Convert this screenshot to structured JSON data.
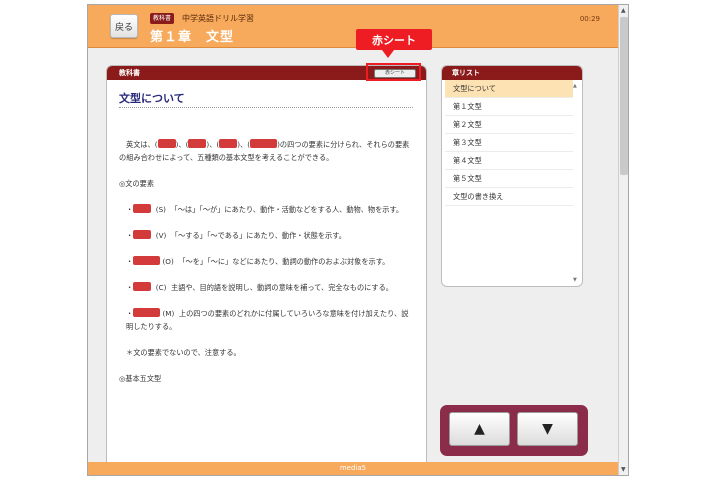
{
  "header": {
    "back_label": "戻る",
    "badge": "教科書",
    "app_title": "中学英語ドリル学習",
    "chapter_title": "第１章　文型",
    "timer": "00:29"
  },
  "content": {
    "panel_label": "教科書",
    "red_sheet_button": "赤シート",
    "doc_title": "文型について",
    "intro_a": "英文は、",
    "intro_sep": "、",
    "intro_b": "の四つの要素に分けられ、それらの要素の組み合わせによって、五種類の基本文型を考えることができる。",
    "section1": "◎文の要素",
    "items": [
      {
        "bullet": "・",
        "code": "(S)",
        "text": "「〜は」「〜が」にあたり、動作・活動などをする人、動物、物を示す。"
      },
      {
        "bullet": "・",
        "code": "(V)",
        "text": "「〜する」「〜である」にあたり、動作・状態を示す。"
      },
      {
        "bullet": "・",
        "code": "(O)",
        "text": "「〜を」「〜に」などにあたり、動詞の動作のおよぶ対象を示す。"
      },
      {
        "bullet": "・",
        "code": "(C)",
        "text": "主語や、目的語を説明し、動詞の意味を補って、完全なものにする。"
      },
      {
        "bullet": "・",
        "code": "(M)",
        "text": "上の四つの要素のどれかに付属していろいろな意味を付け加えたり、説明したりする。"
      }
    ],
    "note": "＊文の要素でないので、注意する。",
    "section2": "◎基本五文型"
  },
  "chapter_list": {
    "header": "章リスト",
    "items": [
      "文型について",
      "第１文型",
      "第２文型",
      "第３文型",
      "第４文型",
      "第５文型",
      "文型の書き換え"
    ],
    "active_index": 0
  },
  "nav": {
    "up": "▲",
    "down": "▼"
  },
  "footer": {
    "brand": "media5"
  },
  "callout": {
    "label": "赤シート"
  },
  "colors": {
    "header_orange": "#f7a95c",
    "dark_red": "#8b1a1a",
    "mask_red": "#d33a3a",
    "callout_red": "#ee1d23",
    "nav_pad": "#8a2c4a",
    "active_item": "#fde2b4"
  }
}
